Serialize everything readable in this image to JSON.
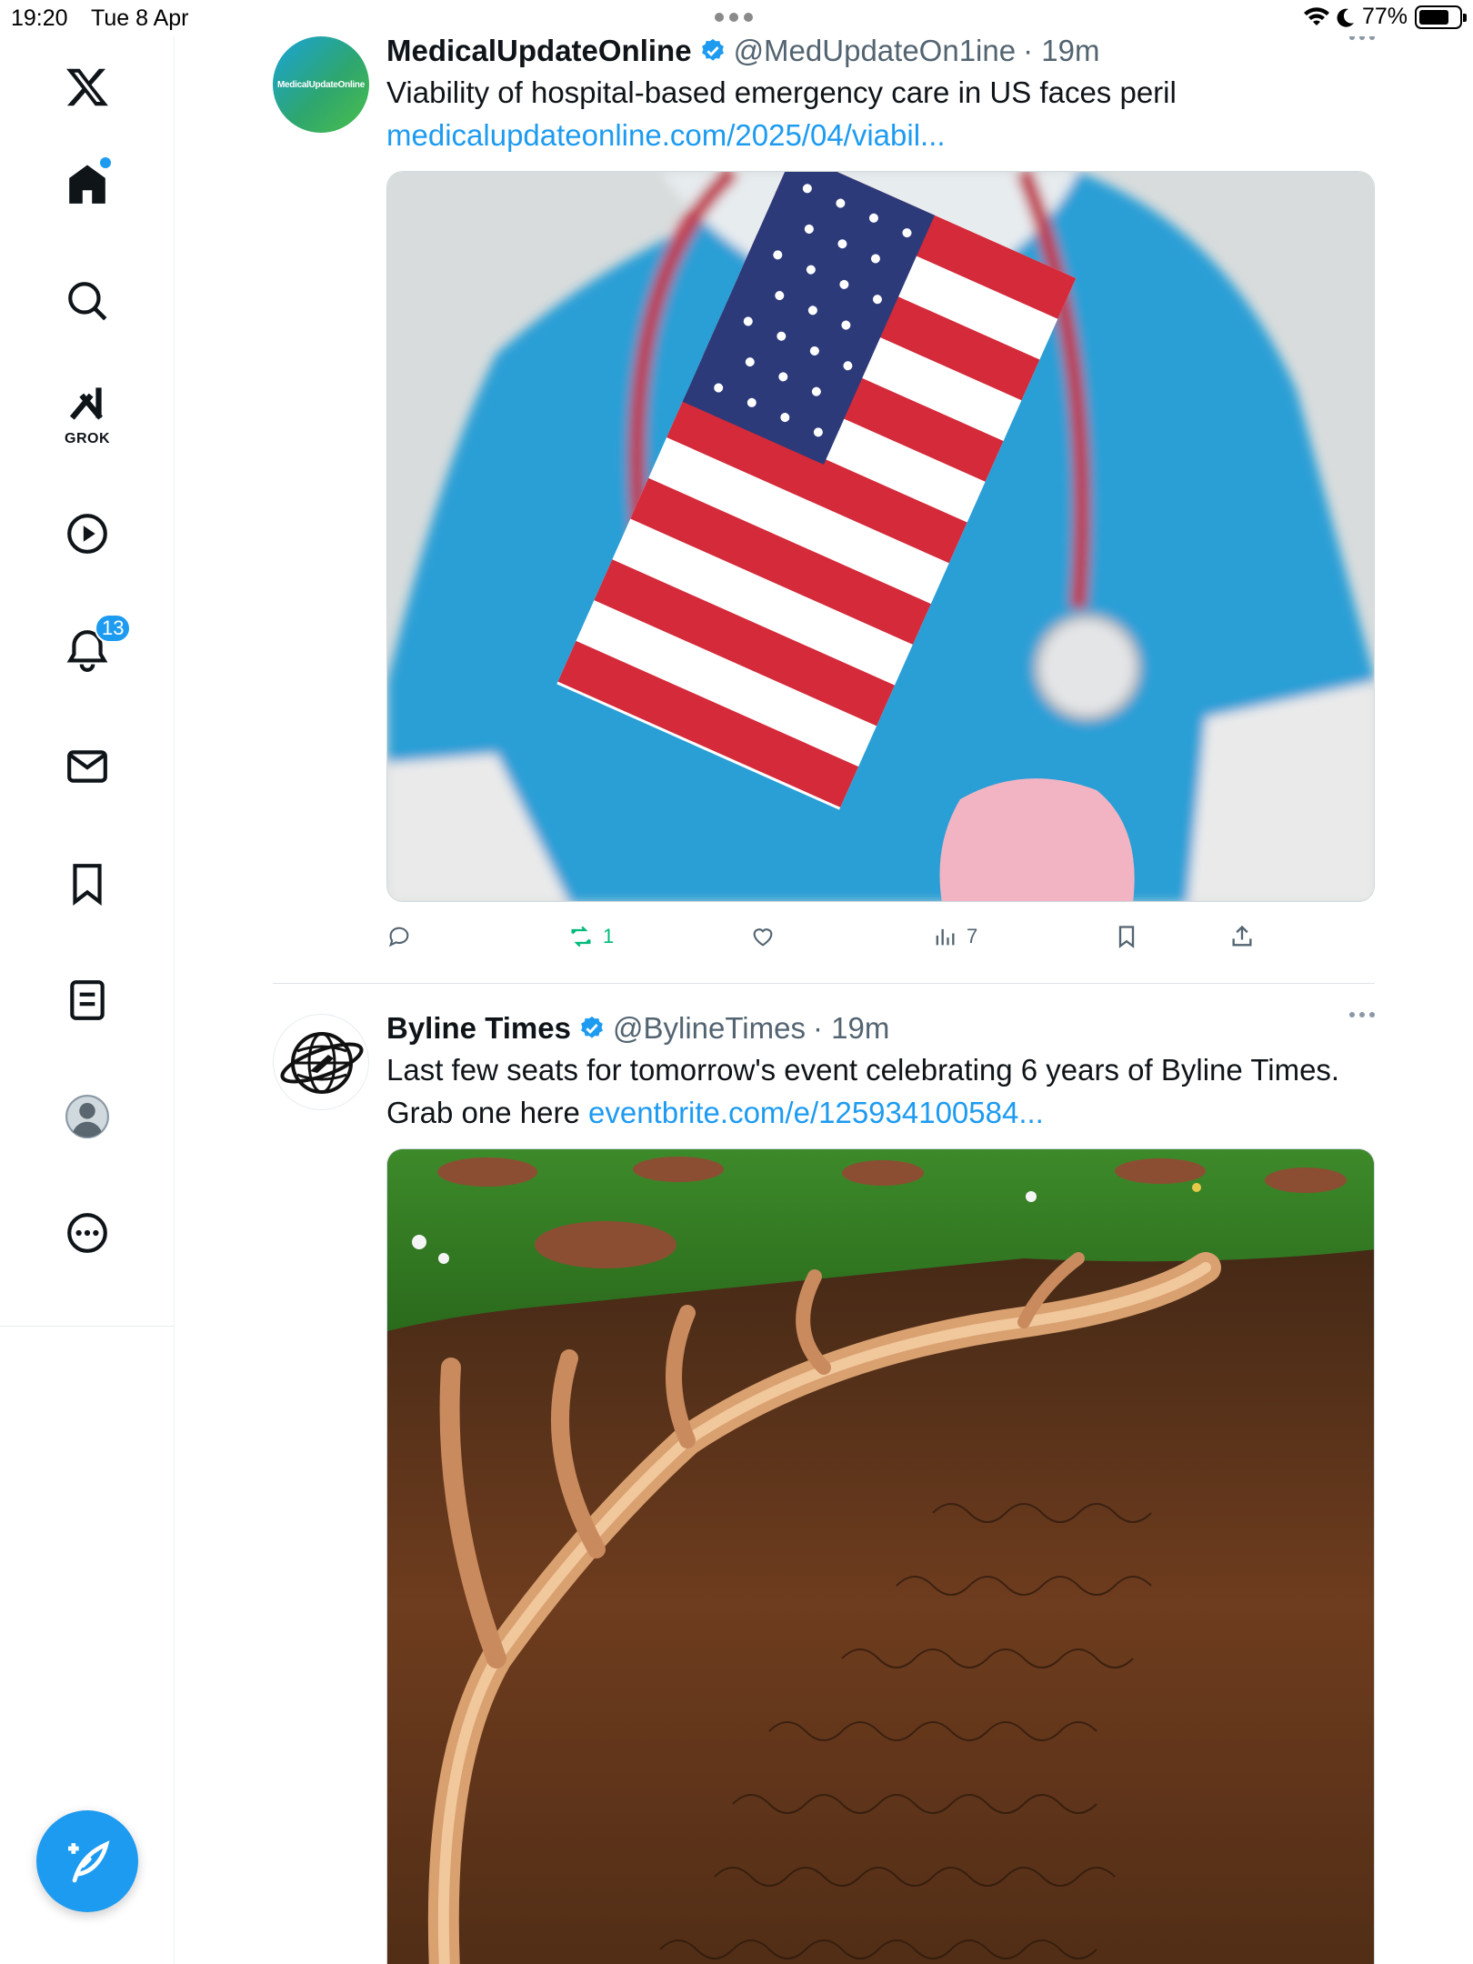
{
  "status_bar": {
    "time": "19:20",
    "date": "Tue 8 Apr",
    "battery": "77%"
  },
  "sidebar": {
    "items": [
      {
        "name": "x-logo"
      },
      {
        "name": "home",
        "has_dot": true
      },
      {
        "name": "search"
      },
      {
        "name": "grok",
        "label": "GROK"
      },
      {
        "name": "video"
      },
      {
        "name": "notifications",
        "badge": "13"
      },
      {
        "name": "messages"
      },
      {
        "name": "bookmarks"
      },
      {
        "name": "lists"
      },
      {
        "name": "profile"
      },
      {
        "name": "more"
      }
    ]
  },
  "tweets": [
    {
      "avatar_text": "MedicalUpdateOnline",
      "name": "MedicalUpdateOnline",
      "handle": "@MedUpdateOn1ine",
      "time": "· 19m",
      "text": "Viability of hospital-based emergency care in US faces peril",
      "link": "medicalupdateonline.com/2025/04/viabil...",
      "retweets": "1",
      "views": "7"
    },
    {
      "name": "Byline Times",
      "handle": "@BylineTimes",
      "time": "· 19m",
      "text": "Last few seats for tomorrow's event celebrating 6 years of Byline Times. Grab one here",
      "link": "eventbrite.com/e/125934100584..."
    }
  ],
  "colors": {
    "accent": "#1d9bf0",
    "retweet": "#00ba7c",
    "text": "#0f1419",
    "muted": "#536471"
  }
}
